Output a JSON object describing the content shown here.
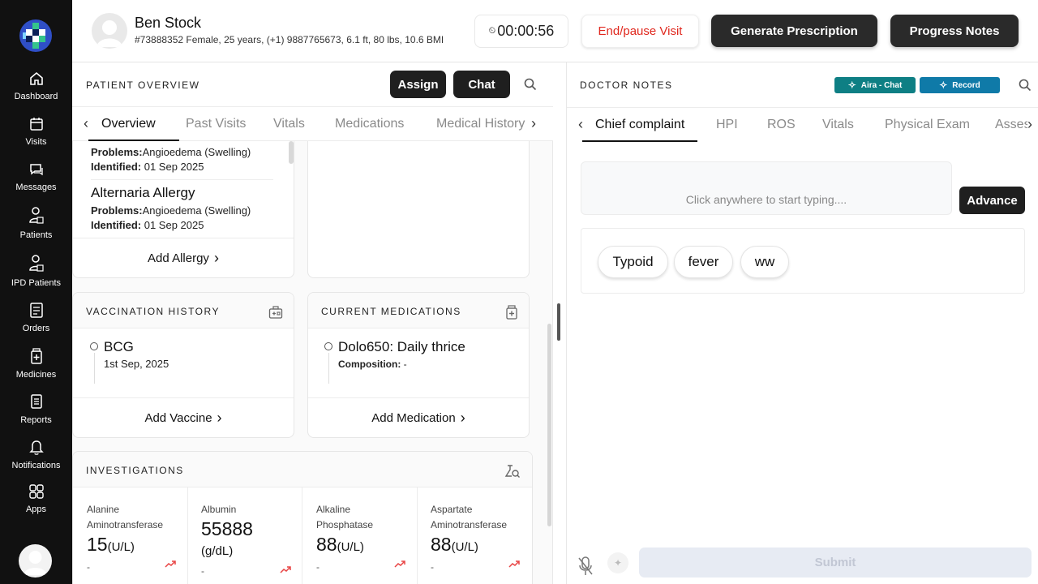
{
  "sidebar": {
    "items": [
      {
        "label": "Dashboard"
      },
      {
        "label": "Visits"
      },
      {
        "label": "Messages"
      },
      {
        "label": "Patients"
      },
      {
        "label": "IPD Patients"
      },
      {
        "label": "Orders"
      },
      {
        "label": "Medicines"
      },
      {
        "label": "Reports"
      },
      {
        "label": "Notifications"
      },
      {
        "label": "Apps"
      }
    ]
  },
  "header": {
    "patient_name": "Ben Stock",
    "patient_info": "#73888352 Female, 25 years, (+1) 9887765673, 6.1 ft, 80 lbs, 10.6 BMI",
    "timer": "00:00:56",
    "end_visit_label": "End/pause Visit",
    "generate_prescription_label": "Generate Prescription",
    "progress_notes_label": "Progress Notes"
  },
  "overview": {
    "title": "PATIENT OVERVIEW",
    "assign_label": "Assign",
    "chat_label": "Chat",
    "tabs": [
      "Overview",
      "Past Visits",
      "Vitals",
      "Medications",
      "Medical History"
    ],
    "allergies": [
      {
        "name": "",
        "problems_label": "Problems:",
        "problems": "Angioedema (Swelling)",
        "identified_label": "Identified:",
        "identified": "01 Sep 2025"
      },
      {
        "name": "Alternaria Allergy",
        "problems_label": "Problems:",
        "problems": "Angioedema (Swelling)",
        "identified_label": "Identified:",
        "identified": "01 Sep 2025"
      }
    ],
    "add_allergy_label": "Add Allergy"
  },
  "vaccination": {
    "title": "VACCINATION HISTORY",
    "items": [
      {
        "name": "BCG",
        "date": "1st Sep, 2025"
      }
    ],
    "add_label": "Add Vaccine"
  },
  "medications": {
    "title": "CURRENT MEDICATIONS",
    "items": [
      {
        "name": "Dolo650: Daily thrice",
        "composition_label": "Composition:",
        "composition": "-"
      }
    ],
    "add_label": "Add Medication"
  },
  "investigations": {
    "title": "INVESTIGATIONS",
    "items": [
      {
        "name_line1": "Alanine",
        "name_line2": "Aminotransferase",
        "value": "15",
        "unit": "(U/L)",
        "sub": "-"
      },
      {
        "name_line1": "Albumin",
        "name_line2": "",
        "value": "55888",
        "unit": "(g/dL)",
        "sub": "-"
      },
      {
        "name_line1": "Alkaline",
        "name_line2": "Phosphatase",
        "value": "88",
        "unit": "(U/L)",
        "sub": "-"
      },
      {
        "name_line1": "Aspartate",
        "name_line2": "Aminotransferase",
        "value": "88",
        "unit": "(U/L)",
        "sub": "-"
      }
    ]
  },
  "notes": {
    "title": "DOCTOR NOTES",
    "aira_label": "Aira - Chat",
    "record_label": "Record",
    "tabs": [
      "Chief complaint",
      "HPI",
      "ROS",
      "Vitals",
      "Physical Exam",
      "Assess"
    ],
    "input_placeholder": "Click anywhere to start typing....",
    "advance_label": "Advance",
    "chips": [
      "Typoid",
      "fever",
      "ww"
    ],
    "submit_label": "Submit"
  },
  "colors": {
    "sidebar_bg": "#111111",
    "end_visit_text": "#e0281e",
    "aira_btn": "#0e7f84",
    "record_btn": "#0f7aa8",
    "trend_red": "#e84545"
  }
}
